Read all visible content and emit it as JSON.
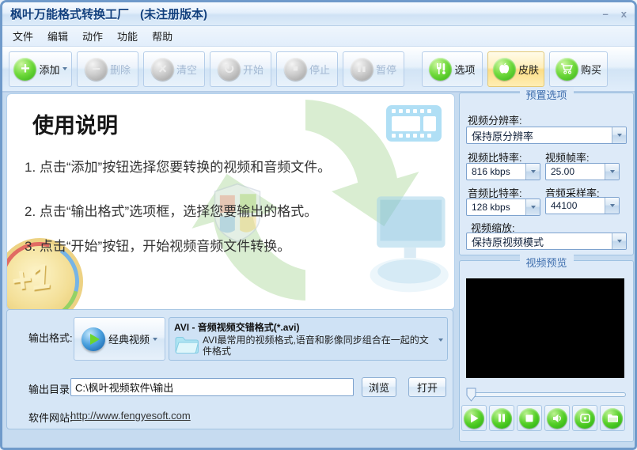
{
  "window": {
    "title": "枫叶万能格式转换工厂",
    "license": "(未注册版本)",
    "minimize_glyph": "–",
    "close_glyph": "x"
  },
  "menubar": {
    "items": [
      {
        "label": "文件"
      },
      {
        "label": "编辑"
      },
      {
        "label": "动作"
      },
      {
        "label": "功能"
      },
      {
        "label": "帮助"
      }
    ]
  },
  "toolbar": {
    "buttons": [
      {
        "label": "添加",
        "icon": "add-plus-icon",
        "glyph": "+",
        "enabled": true,
        "dropdown": true
      },
      {
        "label": "删除",
        "icon": "remove-minus-icon",
        "glyph": "−",
        "enabled": false
      },
      {
        "label": "清空",
        "icon": "clear-x-icon",
        "glyph": "×",
        "enabled": false
      },
      {
        "label": "开始",
        "icon": "start-refresh-icon",
        "glyph": "↻",
        "enabled": false
      },
      {
        "label": "停止",
        "icon": "stop-square-icon",
        "glyph": "■",
        "enabled": false
      },
      {
        "label": "暂停",
        "icon": "pause-bars-icon",
        "glyph": "▮▮",
        "enabled": false
      },
      {
        "label": "选项",
        "icon": "tools-icon",
        "enabled": true
      },
      {
        "label": "皮肤",
        "icon": "apple-icon",
        "enabled": true,
        "highlighted": true
      },
      {
        "label": "购买",
        "icon": "cart-icon",
        "enabled": true
      }
    ]
  },
  "instructions": {
    "title": "使用说明",
    "steps": [
      {
        "text": "1. 点击“添加”按钮选择您要转换的视频和音频文件。"
      },
      {
        "text": "2. 点击“输出格式”选项框，选择您要输出的格式。"
      },
      {
        "text": "3. 点击“开始”按钮，开始视频音频文件转换。"
      }
    ],
    "coin_text": "+1"
  },
  "preset": {
    "title": "预置选项",
    "video_resolution": {
      "label": "视频分辨率:",
      "value": "保持原分辨率"
    },
    "video_bitrate": {
      "label": "视频比特率:",
      "value": "816 kbps"
    },
    "video_framerate": {
      "label": "视频帧率:",
      "value": "25.00"
    },
    "audio_bitrate": {
      "label": "音频比特率:",
      "value": "128 kbps"
    },
    "audio_samplerate": {
      "label": "音频采样率:",
      "value": "44100"
    },
    "video_scale": {
      "label": "视频缩放:",
      "value": "保持原视频模式"
    }
  },
  "preview": {
    "title": "视频预览",
    "controls": [
      {
        "icon": "play-icon"
      },
      {
        "icon": "pause-icon"
      },
      {
        "icon": "stop-icon"
      },
      {
        "icon": "volume-icon"
      },
      {
        "icon": "snapshot-icon"
      },
      {
        "icon": "folder-icon"
      }
    ]
  },
  "output": {
    "format_label": "输出格式:",
    "format_category": "经典视频",
    "format_name": "AVI - 音频视频交错格式(*.avi)",
    "format_description": "AVI最常用的视频格式,语音和影像同步组合在一起的文件格式",
    "directory_label": "输出目录:",
    "directory_value": "C:\\枫叶视频软件\\输出",
    "browse_button": "浏览",
    "open_button": "打开",
    "website_label": "软件网站:",
    "website_url": "http://www.fengyesoft.com"
  },
  "colors": {
    "title_text": "#12407e",
    "accent_green": "#3cb81d",
    "skin_highlight": "#fbdd86",
    "panel_title_blue": "#3f6fae",
    "panel_bg": "#ddeaf8",
    "window_bg": "#c6dbf0"
  }
}
